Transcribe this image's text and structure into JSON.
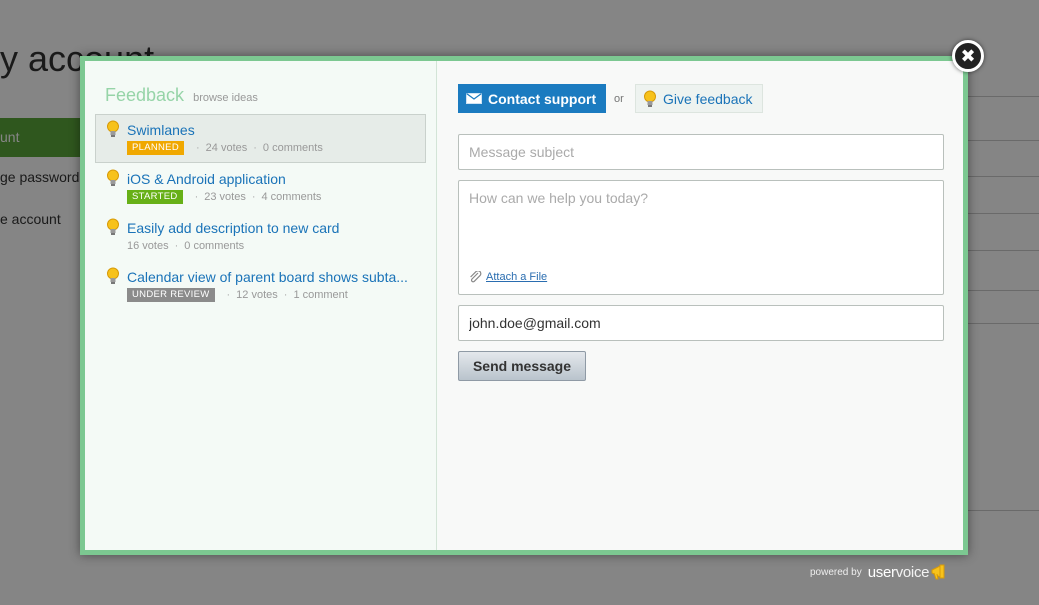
{
  "background": {
    "title": "y account",
    "nav": [
      {
        "label": "unt",
        "active": true
      },
      {
        "label": "ge password",
        "active": false
      },
      {
        "label": "e account",
        "active": false
      }
    ]
  },
  "feedback": {
    "title": "Feedback",
    "browse_link": "browse ideas",
    "ideas": [
      {
        "title": "Swimlanes",
        "status": "PLANNED",
        "status_color": "#f0a800",
        "votes": "24 votes",
        "comments": "0 comments",
        "selected": true
      },
      {
        "title": "iOS & Android application",
        "status": "STARTED",
        "status_color": "#67b017",
        "votes": "23 votes",
        "comments": "4 comments",
        "selected": false
      },
      {
        "title": "Easily add description to new card",
        "status": "",
        "status_color": "",
        "votes": "16 votes",
        "comments": "0 comments",
        "selected": false
      },
      {
        "title": "Calendar view of parent board shows subta...",
        "status": "UNDER REVIEW",
        "status_color": "#8b8b8b",
        "votes": "12 votes",
        "comments": "1 comment",
        "selected": false
      }
    ]
  },
  "contact": {
    "contact_tab": "Contact support",
    "or": "or",
    "feedback_tab": "Give feedback",
    "subject_placeholder": "Message subject",
    "message_placeholder": "How can we help you today?",
    "attach_label": "Attach a File",
    "email_value": "john.doe@gmail.com",
    "send_label": "Send message"
  },
  "footer": {
    "powered_by": "powered by",
    "brand_user": "user",
    "brand_voice": "voice"
  },
  "colors": {
    "accent": "#1b7bc0",
    "modal_border": "#7cc891",
    "feedback_title": "#96d4a8"
  },
  "icons": {
    "close": "close-icon",
    "mail": "mail-icon",
    "bulb": "lightbulb-icon",
    "paperclip": "paperclip-icon"
  }
}
